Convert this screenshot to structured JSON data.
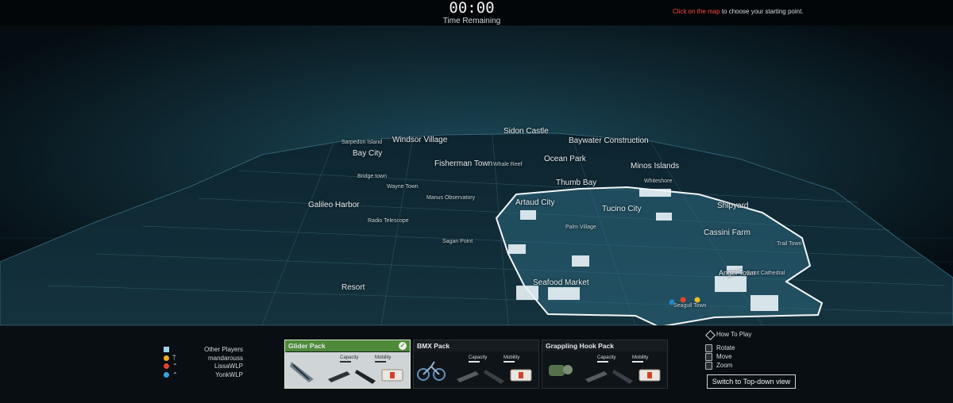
{
  "timer": {
    "value": "00:00",
    "label": "Time Remaining"
  },
  "hint": {
    "accent_text": "Click on the map",
    "rest_text": " to choose your starting point."
  },
  "map": {
    "labels_large": [
      {
        "text": "Windsor Village"
      },
      {
        "text": "Sidon Castle"
      },
      {
        "text": "Baywater Construction"
      },
      {
        "text": "Bay City"
      },
      {
        "text": "Fisherman Town"
      },
      {
        "text": "Ocean Park"
      },
      {
        "text": "Minos Islands"
      },
      {
        "text": "Thumb Bay"
      },
      {
        "text": "Galileo Harbor"
      },
      {
        "text": "Artaud City"
      },
      {
        "text": "Tucino City"
      },
      {
        "text": "Shipyard"
      },
      {
        "text": "Cassini Farm"
      },
      {
        "text": "Seafood Market"
      },
      {
        "text": "Resort"
      }
    ],
    "labels_small": [
      {
        "text": "Sarpedon Island"
      },
      {
        "text": "Whale Reef"
      },
      {
        "text": "Bridge town"
      },
      {
        "text": "Wayne Town"
      },
      {
        "text": "Manus Observatory"
      },
      {
        "text": "Whiteshore"
      },
      {
        "text": "Radio Telescope"
      },
      {
        "text": "Palm Village"
      },
      {
        "text": "Sagan Point"
      },
      {
        "text": "Trail Town"
      },
      {
        "text": "Angel Town"
      },
      {
        "text": "Saint Cathedral"
      },
      {
        "text": "Seagull Town"
      }
    ],
    "pin_colors": [
      "#2a86c8",
      "#e0452a",
      "#e8c22a"
    ]
  },
  "players": {
    "header": "Other Players",
    "list": [
      {
        "name": "mandarouss",
        "color": "#f0b020"
      },
      {
        "name": "LissaWLP",
        "color": "#e0452a"
      },
      {
        "name": "YonkWLP",
        "color": "#3aa0e0"
      }
    ],
    "header_color": "#9fd3ee"
  },
  "packs": [
    {
      "name": "Glider Pack",
      "selected": true,
      "check": "✓",
      "capacity_label": "Capacity",
      "mobility_label": "Mobility",
      "capacity": 0.6,
      "mobility": 0.7
    },
    {
      "name": "BMX Pack",
      "selected": false,
      "capacity_label": "Capacity",
      "mobility_label": "Mobility",
      "capacity": 0.6,
      "mobility": 0.7
    },
    {
      "name": "Grappling Hook Pack",
      "selected": false,
      "capacity_label": "Capacity",
      "mobility_label": "Mobility",
      "capacity": 0.6,
      "mobility": 0.7
    }
  ],
  "help": {
    "how_to_play": "How To Play",
    "rotate": "Rotate",
    "move": "Move",
    "zoom": "Zoom",
    "switch_view": "Switch to Top-down view"
  }
}
